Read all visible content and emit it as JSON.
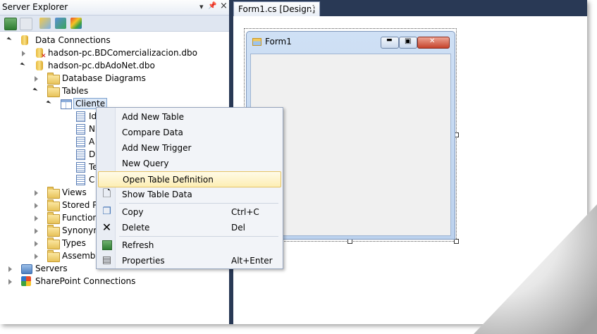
{
  "server_explorer": {
    "title": "Server Explorer",
    "pin_glyph": "📌",
    "close_glyph": "×",
    "dropdown_glyph": "▾",
    "toolbar": [
      {
        "icon": "refresh-icon"
      },
      {
        "icon": "stop-icon"
      },
      {
        "icon": "connect-database-icon"
      },
      {
        "icon": "connect-server-icon"
      }
    ],
    "tree": {
      "data_connections": "Data Connections",
      "conn1": "hadson-pc.BDComercializacion.dbo",
      "conn2": "hadson-pc.dbAdoNet.dbo",
      "database_diagrams": "Database Diagrams",
      "tables": "Tables",
      "cliente": "Cliente",
      "columns": [
        "Id",
        "N",
        "A",
        "D",
        "Te",
        "C"
      ],
      "views": "Views",
      "stored_procedures": "Stored Pr",
      "functions": "Function",
      "synonyms": "Synonym",
      "types": "Types",
      "assemblies": "Assembli",
      "servers": "Servers",
      "sharepoint": "SharePoint Connections"
    }
  },
  "document_tab": {
    "label": "Form1.cs [Design]",
    "close_glyph": "×"
  },
  "form": {
    "title": "Form1",
    "min_glyph": "▬",
    "max_glyph": "▣",
    "close_glyph": "✕"
  },
  "context_menu": {
    "items": [
      {
        "label": "Add New Table",
        "shortcut": ""
      },
      {
        "label": "Compare Data",
        "shortcut": ""
      },
      {
        "label": "Add New Trigger",
        "shortcut": ""
      },
      {
        "label": "New Query",
        "shortcut": ""
      },
      {
        "label": "Open Table Definition",
        "shortcut": ""
      },
      {
        "label": "Show Table Data",
        "shortcut": ""
      },
      {
        "label": "Copy",
        "shortcut": "Ctrl+C"
      },
      {
        "label": "Delete",
        "shortcut": "Del"
      },
      {
        "label": "Refresh",
        "shortcut": ""
      },
      {
        "label": "Properties",
        "shortcut": "Alt+Enter"
      }
    ],
    "highlighted": "Open Table Definition"
  },
  "colors": {
    "ide_background": "#293955",
    "highlight": "#fdeeb4",
    "menu_background": "#f2f4f8"
  }
}
